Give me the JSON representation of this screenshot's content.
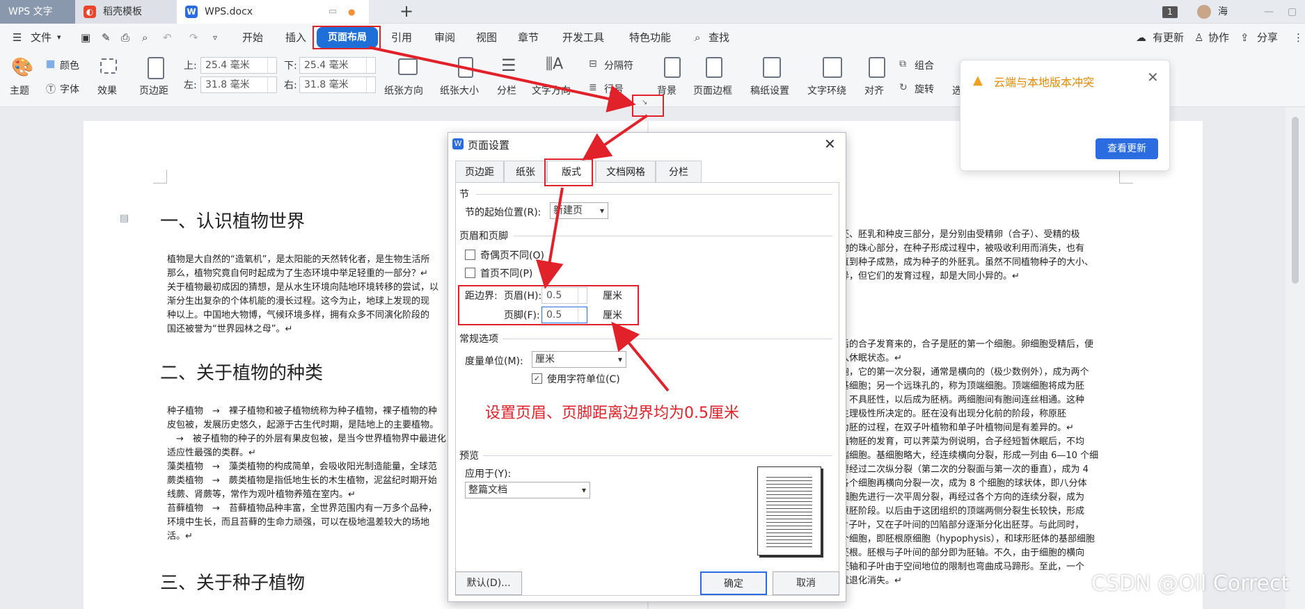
{
  "app_tabs": [
    {
      "label": "WPS 文字"
    },
    {
      "label": "稻壳模板"
    },
    {
      "label": "WPS.docx"
    }
  ],
  "titlebar": {
    "user": "海",
    "badge": "1"
  },
  "menu": {
    "file": "文件",
    "items": [
      "开始",
      "插入",
      "页面布局",
      "引用",
      "审阅",
      "视图",
      "章节",
      "开发工具",
      "特色功能"
    ],
    "search": "查找",
    "update": "有更新",
    "collab": "协作",
    "share": "分享"
  },
  "ribbon": {
    "theme": "主题",
    "colors": "颜色",
    "fonts": "字体",
    "effects": "效果",
    "margins": "页边距",
    "top_label": "上:",
    "top_value": "25.4 毫米",
    "bottom_label": "下:",
    "bottom_value": "25.4 毫米",
    "left_label": "左:",
    "left_value": "31.8 毫米",
    "right_label": "右:",
    "right_value": "31.8 毫米",
    "orientation": "纸张方向",
    "size": "纸张大小",
    "columns": "分栏",
    "text_direction": "文字方向",
    "separator": "分隔符",
    "line_numbers": "行号",
    "background": "背景",
    "page_border": "页面边框",
    "grid_paper": "稿纸设置",
    "wrap": "文字环绕",
    "align": "对齐",
    "group": "组合",
    "rotate": "旋转",
    "select": "选"
  },
  "popup": {
    "title": "云端与本地版本冲突",
    "button": "查看更新"
  },
  "document": {
    "h1": "一、认识植物世界",
    "h2": "二、关于植物的种类",
    "h3": "三、关于种子植物",
    "p1": [
      "植物是大自然的“造氧机”，是太阳能的天然转化者，是生物生活所",
      "那么，植物究竟自何时起成为了生态环境中举足轻重的一部分？↵",
      "关于植物最初成因的猜想，是从水生环境向陆地环境转移的尝试，以",
      "渐分生出复杂的个体机能的漫长过程。这今为止，地球上发现的现",
      "种以上。中国地大物博，气候环境多样，拥有众多不同演化阶段的",
      "国还被誉为“世界园林之母”。↵"
    ],
    "p2": [
      "种子植物　→　裸子植物和被子植物统称为种子植物，裸子植物的种",
      "皮包被，发展历史悠久，起源于古生代时期，是陆地上的主要植物。",
      "　→　被子植物的种子的外层有果皮包被，是当今世界植物界中最进化",
      "适应性最强的类群。↵",
      "藻类植物　→　藻类植物的构成简单，会吸收阳光制造能量，全球范",
      "蕨类植物　→　蕨类植物是指低地生长的木生植物，泥盆纪时期开始",
      "线蕨、肾蕨等，常作为观叶植物养殖在室内。↵",
      "苔藓植物　→　苔藓植物品种丰富，全世界范围内有一万多个品种，",
      "环境中生长，而且苔藓的生命力顽强，可以在极地温差较大的场地",
      "活。↵"
    ],
    "r1": [
      "括胚、胚乳和种皮三部分，是分别由受精卵（合子）、受精的极",
      "植物的珠心部分，在种子形成过程中，被吸收利用而消失，也有",
      "，直到种子成熟，成为种子的外胚乳。虽然不同植物种子的大小、",
      "差异，但它们的发育过程，却是大同小异的。↵"
    ],
    "r2": [
      "精后的合子发育来的，合子是胚的第一个细胞。卵细胞受精后，便",
      "进入休眠状态。↵",
      "细胞，它的第一次分裂，通常是横向的（极少数例外），成为两个",
      "为基细胞；另一个远珠孔的，称为顶端细胞。顶端细胞将成为胚",
      "性，不具胚性，以后成为胚柄。两细胞间有胞间连丝相通。这种",
      "的生理极性所决定的。胚在没有出现分化前的阶段，称原胚",
      "展为胚的过程，在双子叶植物和单子叶植物间是有差异的。↵",
      "叶植物胚的发育，可以荠菜为例说明，合子经短暂休眠后，不均",
      "顶端细胞。基细胞略大，经连续横向分裂，形成一列由 6—10 个细",
      "主要经过二次纵分裂（第二次的分裂面与第一次的垂直），成为 4",
      "后各个细胞再横向分裂一次，成为 8 个细胞的球状体，即八分体",
      "各细胞先进行一次平周分裂，再经过各个方向的连续分裂，成为",
      "形原胚阶段。以后由于这团组织的顶端两侧分裂生长较快，形成",
      "2 片子叶，又在子叶间的凹陷部分逐渐分化出胚芽。与此同时，",
      "一个细胞，即胚根原细胞（hypophysis），和球形胚体的基部细胞",
      "为胚根。胚根与子叶间的部分即为胚轴。不久，由于细胞的横向",
      "而胚轴和子叶由于空间地位的限制也弯曲成马蹄形。至此，一个",
      "也就退化消失。↵"
    ]
  },
  "dialog": {
    "title": "页面设置",
    "tabs": [
      "页边距",
      "纸张",
      "版式",
      "文档网格",
      "分栏"
    ],
    "section_label": "节",
    "section_start_label": "节的起始位置(R):",
    "section_start_value": "新建页",
    "hf_label": "页眉和页脚",
    "odd_even": "奇偶页不同(O)",
    "first_page": "首页不同(P)",
    "from_edge": "距边界:",
    "header_label": "页眉(H):",
    "header_value": "0.5",
    "footer_label": "页脚(F):",
    "footer_value": "0.5",
    "unit": "厘米",
    "general_label": "常规选项",
    "measure_label": "度量单位(M):",
    "measure_value": "厘米",
    "char_units": "使用字符单位(C)",
    "preview_label": "预览",
    "apply_label": "应用于(Y):",
    "apply_value": "整篇文档",
    "default_btn": "默认(D)...",
    "ok_btn": "确定",
    "cancel_btn": "取消"
  },
  "annotation": "设置页眉、页脚距离边界均为0.5厘米",
  "watermark": "CSDN @Oll Correct"
}
